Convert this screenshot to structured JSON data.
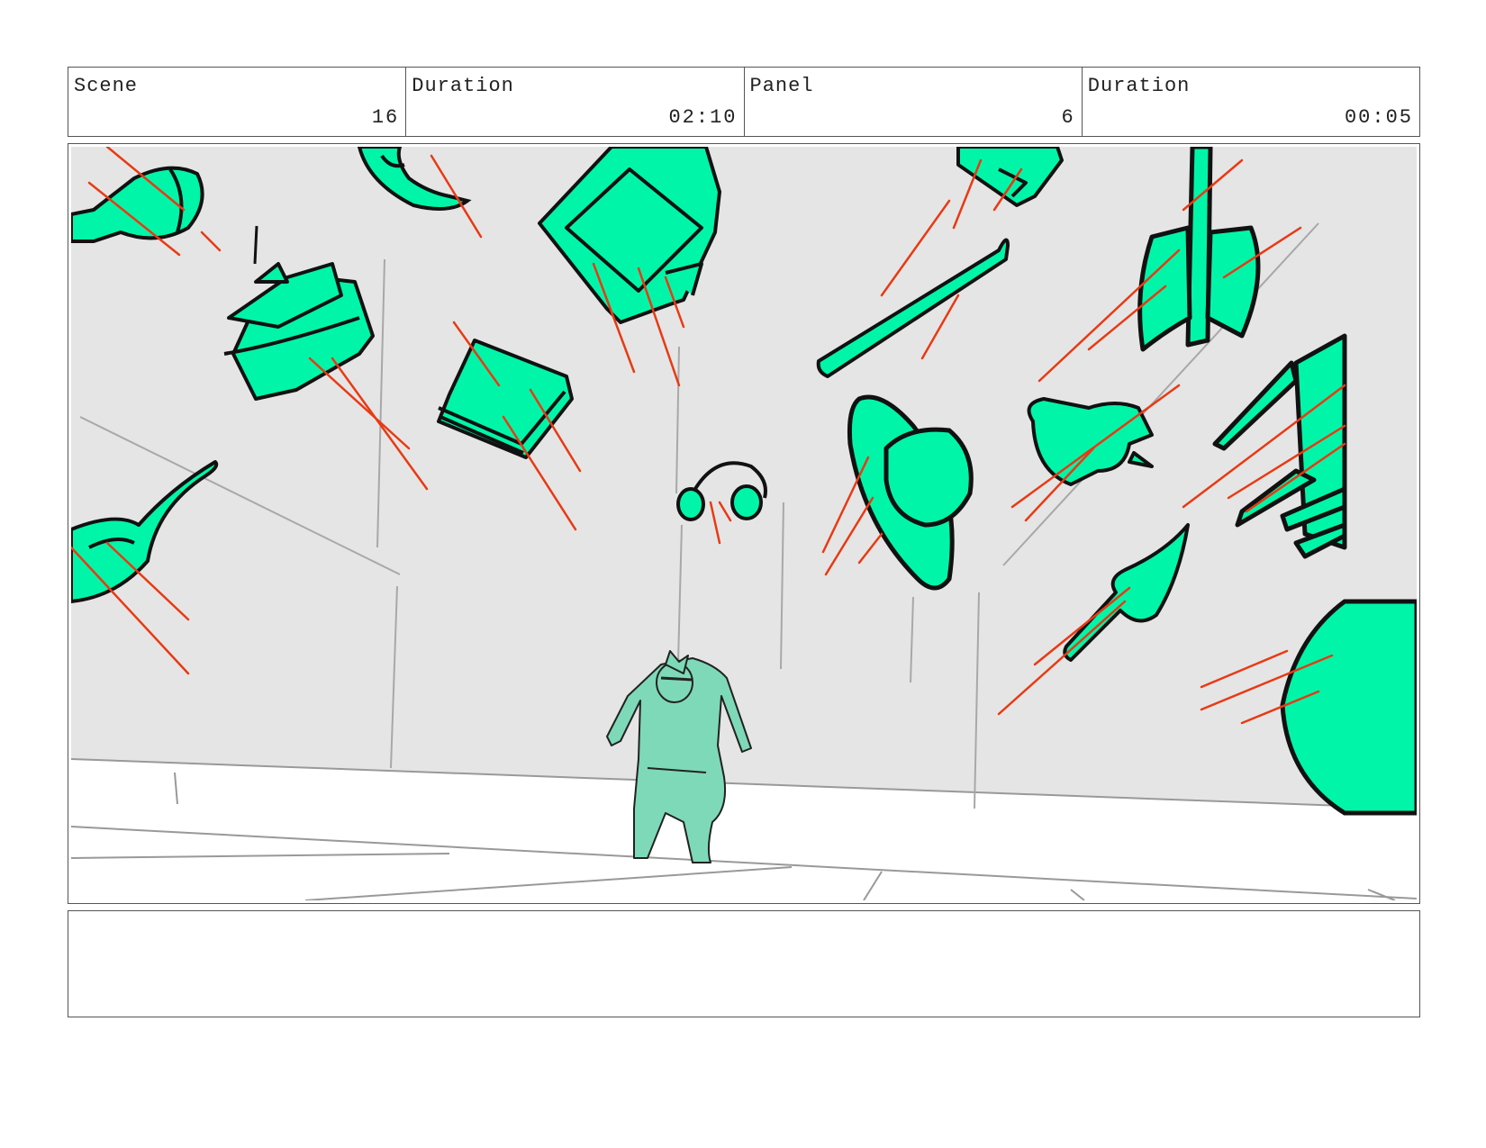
{
  "header": {
    "cells": [
      {
        "label": "Scene",
        "value": "16"
      },
      {
        "label": "Duration",
        "value": "02:10"
      },
      {
        "label": "Panel",
        "value": "6"
      },
      {
        "label": "Duration",
        "value": "00:05"
      }
    ]
  },
  "colors": {
    "object_fill": "#00f5a8",
    "character_fill": "#7ed9b8",
    "speed_lines": "#e83a14",
    "wall": "#e5e5e5",
    "outline": "#111111"
  },
  "drawing": {
    "flying_objects": [
      "bottle-icon",
      "cake-icon",
      "teapot-icon",
      "book-icon",
      "picture-frame-icon",
      "padlock-icon",
      "baseball-bat-icon",
      "axe-icon",
      "headphones-icon",
      "hat-icon",
      "watering-can-icon",
      "chair-icon",
      "frying-pan-icon",
      "quill-pen-icon",
      "balloon-icon"
    ],
    "character": "falling-character"
  },
  "notes": {
    "text": ""
  }
}
